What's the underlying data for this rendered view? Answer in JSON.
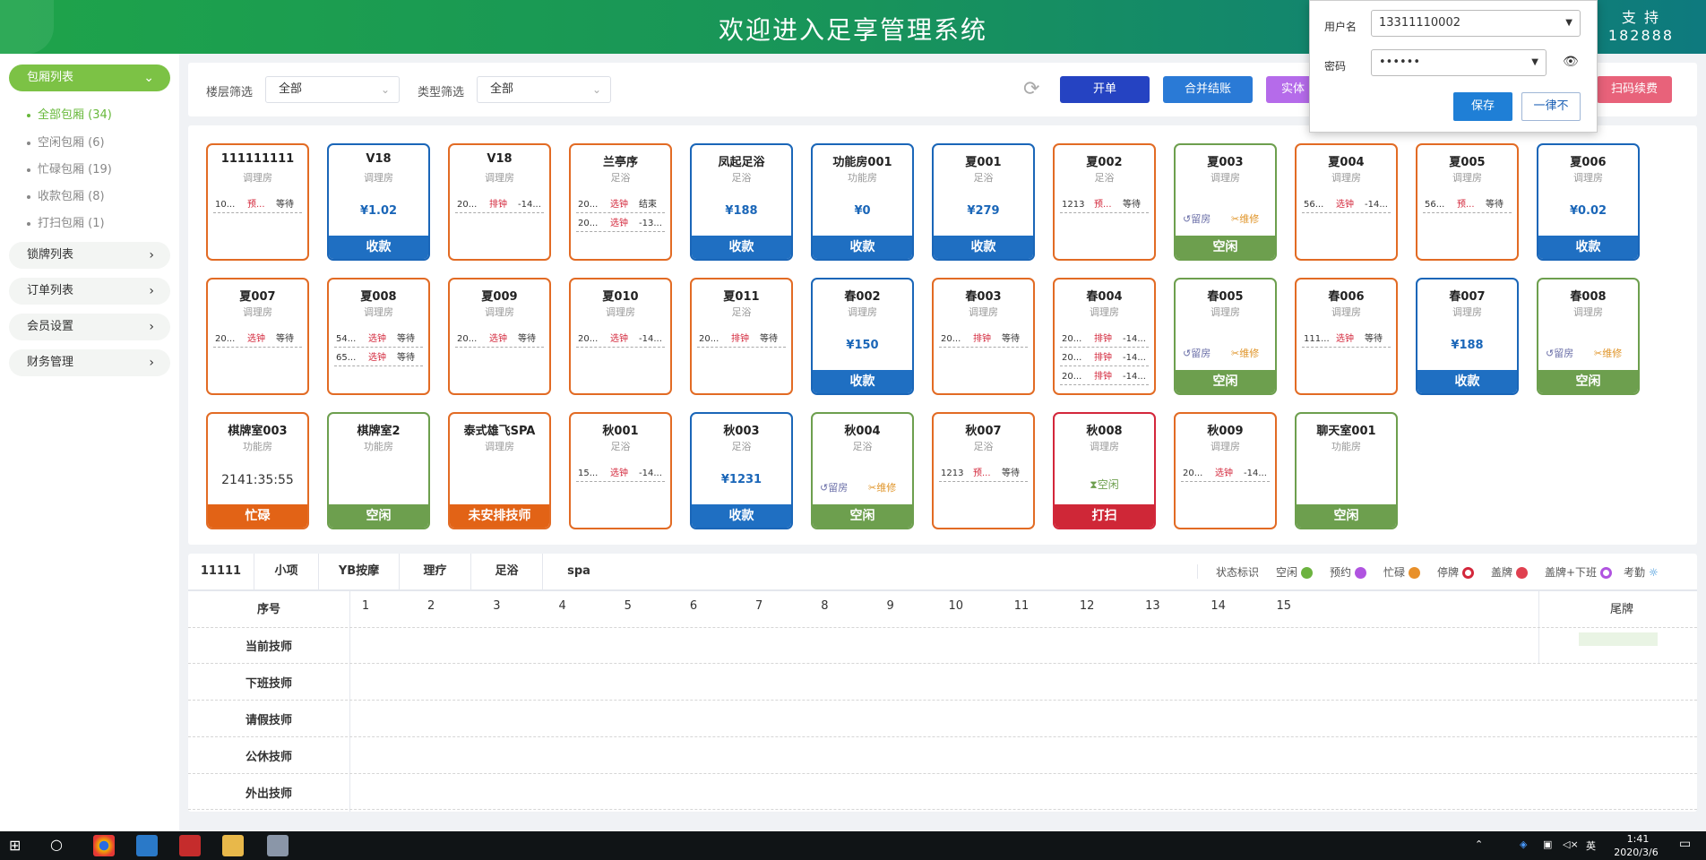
{
  "header": {
    "title": "欢迎进入足享管理系统",
    "support_line1": "支 持",
    "support_line2": "182888"
  },
  "sidebar": {
    "room_list": "包厢列表",
    "sub_items": [
      "全部包厢 (34)",
      "空闲包厢 (6)",
      "忙碌包厢 (19)",
      "收款包厢 (8)",
      "打扫包厢 (1)"
    ],
    "sections": [
      "锁牌列表",
      "订单列表",
      "会员设置",
      "财务管理"
    ]
  },
  "filters": {
    "floor_label": "楼层筛选",
    "floor_value": "全部",
    "type_label": "类型筛选",
    "type_value": "全部"
  },
  "actions": {
    "open": "开单",
    "merge": "合并结账",
    "physical": "实体",
    "scan": "扫码续费"
  },
  "login_popup": {
    "user_label": "用户名",
    "user_value": "13311110002",
    "pwd_label": "密码",
    "pwd_value": "••••••",
    "save": "保存",
    "never": "一律不"
  },
  "colors": {
    "busy": "#e26b24",
    "charge": "#1a66b8",
    "idle": "#6d9f4e",
    "clean": "#d3273b",
    "accent_green": "#7cc245"
  },
  "rooms": [
    {
      "name": "111111111",
      "type": "调理房",
      "rows": [
        [
          "10...",
          "预...",
          "等待"
        ]
      ]
    },
    {
      "name": "V18",
      "type": "调理房",
      "center": "¥1.02",
      "band": "收款"
    },
    {
      "name": "V18",
      "type": "调理房",
      "rows": [
        [
          "20...",
          "排钟",
          "-14..."
        ]
      ]
    },
    {
      "name": "兰亭序",
      "type": "足浴",
      "rows": [
        [
          "20...",
          "选钟",
          "结束"
        ],
        [
          "20...",
          "选钟",
          "-13..."
        ]
      ]
    },
    {
      "name": "凤起足浴",
      "type": "足浴",
      "center": "¥188",
      "band": "收款"
    },
    {
      "name": "功能房001",
      "type": "功能房",
      "center": "¥0",
      "band": "收款"
    },
    {
      "name": "夏001",
      "type": "足浴",
      "center": "¥279",
      "band": "收款"
    },
    {
      "name": "夏002",
      "type": "足浴",
      "rows": [
        [
          "1213",
          "预...",
          "等待"
        ]
      ]
    },
    {
      "name": "夏003",
      "type": "调理房",
      "act1": "留房",
      "act2": "维修",
      "band": "空闲"
    },
    {
      "name": "夏004",
      "type": "调理房",
      "rows": [
        [
          "56...",
          "选钟",
          "-14..."
        ]
      ]
    },
    {
      "name": "夏005",
      "type": "调理房",
      "rows": [
        [
          "56...",
          "预...",
          "等待"
        ]
      ]
    },
    {
      "name": "夏006",
      "type": "调理房",
      "center": "¥0.02",
      "band": "收款"
    },
    {
      "name": "夏007",
      "type": "调理房",
      "rows": [
        [
          "20...",
          "选钟",
          "等待"
        ]
      ]
    },
    {
      "name": "夏008",
      "type": "调理房",
      "rows": [
        [
          "54...",
          "选钟",
          "等待"
        ],
        [
          "65...",
          "选钟",
          "等待"
        ]
      ]
    },
    {
      "name": "夏009",
      "type": "调理房",
      "rows": [
        [
          "20...",
          "选钟",
          "等待"
        ]
      ]
    },
    {
      "name": "夏010",
      "type": "调理房",
      "rows": [
        [
          "20...",
          "选钟",
          "-14..."
        ]
      ]
    },
    {
      "name": "夏011",
      "type": "足浴",
      "rows": [
        [
          "20...",
          "排钟",
          "等待"
        ]
      ]
    },
    {
      "name": "春002",
      "type": "调理房",
      "center": "¥150",
      "band": "收款"
    },
    {
      "name": "春003",
      "type": "调理房",
      "rows": [
        [
          "20...",
          "排钟",
          "等待"
        ]
      ]
    },
    {
      "name": "春004",
      "type": "调理房",
      "rows": [
        [
          "20...",
          "排钟",
          "-14..."
        ],
        [
          "20...",
          "排钟",
          "-14..."
        ],
        [
          "20...",
          "排钟",
          "-14..."
        ]
      ]
    },
    {
      "name": "春005",
      "type": "调理房",
      "act1": "留房",
      "act2": "维修",
      "band": "空闲"
    },
    {
      "name": "春006",
      "type": "调理房",
      "rows": [
        [
          "111...",
          "选钟",
          "等待"
        ]
      ]
    },
    {
      "name": "春007",
      "type": "调理房",
      "center": "¥188",
      "band": "收款"
    },
    {
      "name": "春008",
      "type": "调理房",
      "act1": "留房",
      "act2": "维修",
      "band": "空闲"
    },
    {
      "name": "棋牌室003",
      "type": "功能房",
      "timer": "2141:35:55",
      "band": "忙碌"
    },
    {
      "name": "棋牌室2",
      "type": "功能房",
      "band": "空闲"
    },
    {
      "name": "泰式雄飞SPA",
      "type": "调理房",
      "band": "未安排技师"
    },
    {
      "name": "秋001",
      "type": "足浴",
      "rows": [
        [
          "15...",
          "选钟",
          "-14..."
        ]
      ]
    },
    {
      "name": "秋003",
      "type": "足浴",
      "center": "¥1231",
      "band": "收款"
    },
    {
      "name": "秋004",
      "type": "足浴",
      "act1": "留房",
      "act2": "维修",
      "band": "空闲"
    },
    {
      "name": "秋007",
      "type": "足浴",
      "rows": [
        [
          "1213",
          "预...",
          "等待"
        ]
      ]
    },
    {
      "name": "秋008",
      "type": "调理房",
      "idle": "空闲",
      "band": "打扫"
    },
    {
      "name": "秋009",
      "type": "调理房",
      "rows": [
        [
          "20...",
          "选钟",
          "-14..."
        ]
      ]
    },
    {
      "name": "聊天室001",
      "type": "功能房",
      "band": "空闲"
    }
  ],
  "tech_tabs": [
    "11111",
    "小项",
    "YB按摩",
    "理疗",
    "足浴",
    "spa"
  ],
  "legend": {
    "title": "状态标识",
    "items": [
      "空闲",
      "预约",
      "忙碌",
      "停牌",
      "盖牌",
      "盖牌+下班",
      "考勤"
    ]
  },
  "tech_table": {
    "seq_label": "序号",
    "columns": [
      "1",
      "2",
      "3",
      "4",
      "5",
      "6",
      "7",
      "8",
      "9",
      "10",
      "11",
      "12",
      "13",
      "14",
      "15"
    ],
    "tail_label": "尾牌",
    "rows": [
      "当前技师",
      "下班技师",
      "请假技师",
      "公休技师",
      "外出技师"
    ]
  },
  "taskbar": {
    "time": "1:41",
    "date": "2020/3/6",
    "ime": "英"
  }
}
